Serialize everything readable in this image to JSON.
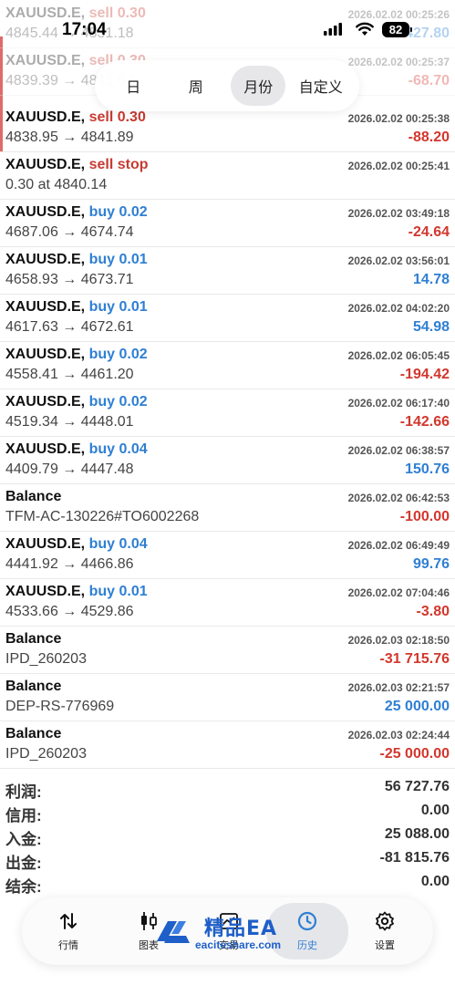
{
  "status_bar": {
    "time": "17:04",
    "battery": "82",
    "icons": [
      "cellular-signal-icon",
      "wifi-icon",
      "battery-icon"
    ]
  },
  "period_tabs": [
    {
      "label": "日",
      "active": false
    },
    {
      "label": "周",
      "active": false
    },
    {
      "label": "月份",
      "active": true
    },
    {
      "label": "自定义",
      "active": false
    }
  ],
  "faded_rows": [
    {
      "symbol": "XAUUSD.E,",
      "side": "sell 0.30",
      "side_type": "sell",
      "time": "2026.02.02 00:25:26",
      "prices": "4845.44 → 4831.18",
      "amount": "427.80",
      "sign": "pos"
    },
    {
      "symbol": "XAUUSD.E,",
      "side": "sell 0.30",
      "side_type": "sell",
      "time": "2026.02.02 00:25:37",
      "prices": "4839.39 → 4841.67",
      "amount": "-68.70",
      "sign": "neg"
    }
  ],
  "rows": [
    {
      "symbol": "XAUUSD.E,",
      "side": "sell 0.30",
      "side_type": "sell",
      "time": "2026.02.02 00:25:38",
      "prices": "4838.95 → 4841.89",
      "amount": "-88.20",
      "sign": "neg"
    },
    {
      "symbol": "XAUUSD.E,",
      "side": "sell stop",
      "side_type": "sell",
      "time": "2026.02.02 00:25:41",
      "prices": "0.30 at 4840.14",
      "amount": "",
      "sign": ""
    },
    {
      "symbol": "XAUUSD.E,",
      "side": "buy 0.02",
      "side_type": "buy",
      "time": "2026.02.02 03:49:18",
      "prices": "4687.06 → 4674.74",
      "amount": "-24.64",
      "sign": "neg"
    },
    {
      "symbol": "XAUUSD.E,",
      "side": "buy 0.01",
      "side_type": "buy",
      "time": "2026.02.02 03:56:01",
      "prices": "4658.93 → 4673.71",
      "amount": "14.78",
      "sign": "pos"
    },
    {
      "symbol": "XAUUSD.E,",
      "side": "buy 0.01",
      "side_type": "buy",
      "time": "2026.02.02 04:02:20",
      "prices": "4617.63 → 4672.61",
      "amount": "54.98",
      "sign": "pos"
    },
    {
      "symbol": "XAUUSD.E,",
      "side": "buy 0.02",
      "side_type": "buy",
      "time": "2026.02.02 06:05:45",
      "prices": "4558.41 → 4461.20",
      "amount": "-194.42",
      "sign": "neg"
    },
    {
      "symbol": "XAUUSD.E,",
      "side": "buy 0.02",
      "side_type": "buy",
      "time": "2026.02.02 06:17:40",
      "prices": "4519.34 → 4448.01",
      "amount": "-142.66",
      "sign": "neg"
    },
    {
      "symbol": "XAUUSD.E,",
      "side": "buy 0.04",
      "side_type": "buy",
      "time": "2026.02.02 06:38:57",
      "prices": "4409.79 → 4447.48",
      "amount": "150.76",
      "sign": "pos"
    },
    {
      "symbol": "Balance",
      "side": "",
      "side_type": "",
      "time": "2026.02.02 06:42:53",
      "prices": "TFM-AC-130226#TO6002268",
      "amount": "-100.00",
      "sign": "neg"
    },
    {
      "symbol": "XAUUSD.E,",
      "side": "buy 0.04",
      "side_type": "buy",
      "time": "2026.02.02 06:49:49",
      "prices": "4441.92 → 4466.86",
      "amount": "99.76",
      "sign": "pos"
    },
    {
      "symbol": "XAUUSD.E,",
      "side": "buy 0.01",
      "side_type": "buy",
      "time": "2026.02.02 07:04:46",
      "prices": "4533.66 → 4529.86",
      "amount": "-3.80",
      "sign": "neg"
    },
    {
      "symbol": "Balance",
      "side": "",
      "side_type": "",
      "time": "2026.02.03 02:18:50",
      "prices": "IPD_260203",
      "amount": "-31 715.76",
      "sign": "neg"
    },
    {
      "symbol": "Balance",
      "side": "",
      "side_type": "",
      "time": "2026.02.03 02:21:57",
      "prices": "DEP-RS-776969",
      "amount": "25 000.00",
      "sign": "pos"
    },
    {
      "symbol": "Balance",
      "side": "",
      "side_type": "",
      "time": "2026.02.03 02:24:44",
      "prices": "IPD_260203",
      "amount": "-25 000.00",
      "sign": "neg"
    }
  ],
  "summary": [
    {
      "label": "利润:",
      "value": "56 727.76"
    },
    {
      "label": "信用:",
      "value": "0.00"
    },
    {
      "label": "入金:",
      "value": "25 088.00"
    },
    {
      "label": "出金:",
      "value": "-81 815.76"
    },
    {
      "label": "结余:",
      "value": "0.00"
    }
  ],
  "bottom_nav": [
    {
      "label": "行情",
      "icon": "quotes-arrows-icon",
      "active": false
    },
    {
      "label": "图表",
      "icon": "candlestick-chart-icon",
      "active": false
    },
    {
      "label": "交易",
      "icon": "trade-chart-icon",
      "active": false
    },
    {
      "label": "历史",
      "icon": "history-clock-icon",
      "active": true
    },
    {
      "label": "设置",
      "icon": "settings-gear-icon",
      "active": false
    }
  ],
  "watermark": {
    "title": "精品EA",
    "subtitle": "eaciteshare.com"
  },
  "colors": {
    "sell": "#c73b32",
    "buy": "#2f7fd3",
    "negative": "#d2372d",
    "positive": "#2f7fd3",
    "active_nav": "#2f7fd3",
    "watermark": "#1f5fc8"
  }
}
